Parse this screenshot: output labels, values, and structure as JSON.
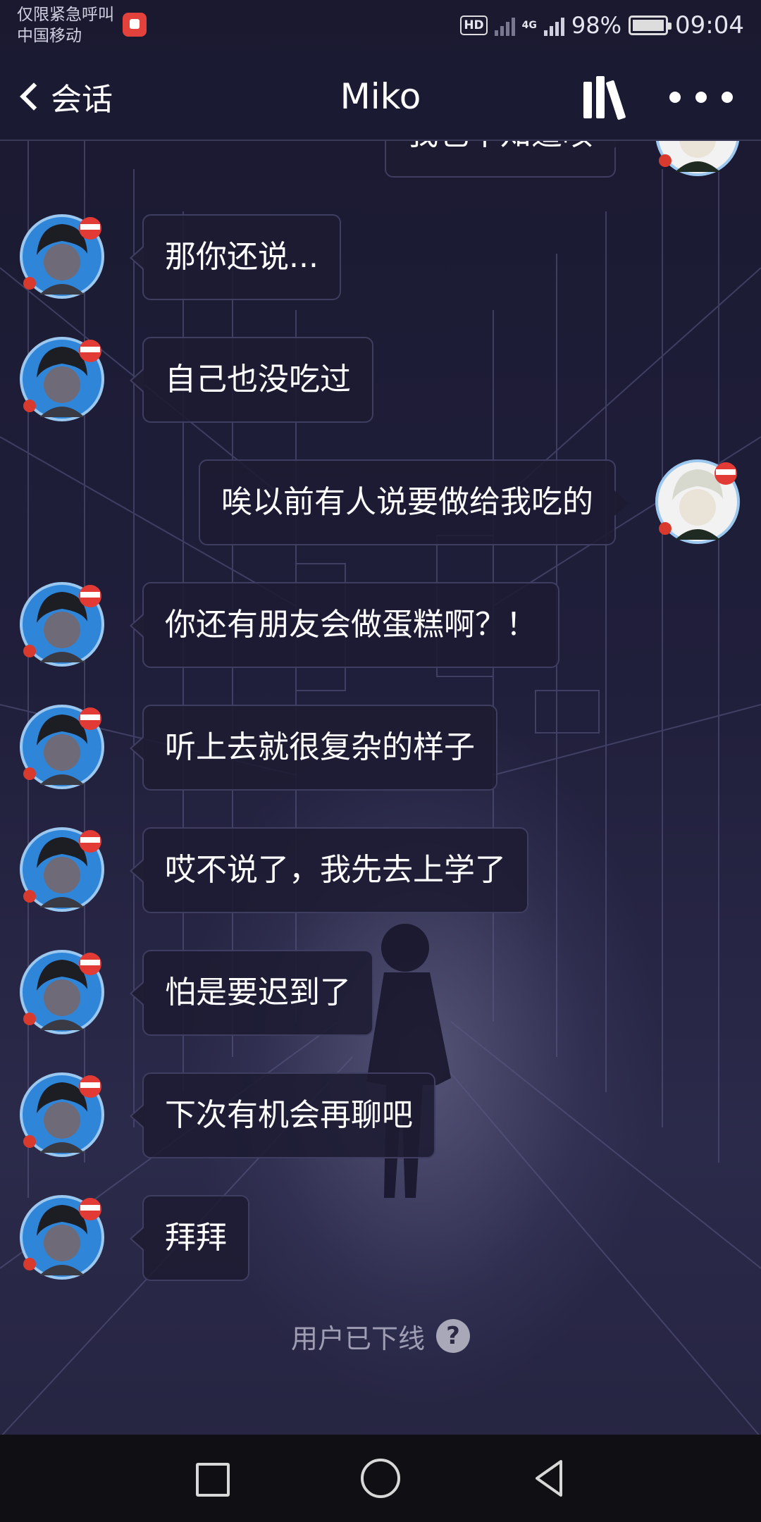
{
  "status_bar": {
    "carrier_line1": "仅限紧急呼叫",
    "carrier_line2": "中国移动",
    "hd": "HD",
    "network": "4G",
    "battery": "98%",
    "time": "09:04"
  },
  "header": {
    "back_label": "会话",
    "title": "Miko",
    "icons": [
      "back-chevron-icon",
      "bookshelf-icon",
      "more-dots-icon"
    ]
  },
  "messages": [
    {
      "side": "right",
      "text": "我也不知道咳"
    },
    {
      "side": "left",
      "text": "那你还说..."
    },
    {
      "side": "left",
      "text": "自己也没吃过"
    },
    {
      "side": "right",
      "text": "唉以前有人说要做给我吃的"
    },
    {
      "side": "left",
      "text": "你还有朋友会做蛋糕啊？！"
    },
    {
      "side": "left",
      "text": "听上去就很复杂的样子"
    },
    {
      "side": "left",
      "text": "哎不说了，我先去上学了"
    },
    {
      "side": "left",
      "text": "怕是要迟到了"
    },
    {
      "side": "left",
      "text": "下次有机会再聊吧"
    },
    {
      "side": "left",
      "text": "拜拜"
    }
  ],
  "offline_notice": "用户已下线",
  "help_symbol": "?",
  "nav": [
    "recent-apps-icon",
    "home-icon",
    "back-triangle-icon"
  ],
  "colors": {
    "background": "#1b1a33",
    "bubble": "#1c1b32",
    "bubble_border": "#3f3e60",
    "offline_text": "#9e9db4",
    "navbar": "#0f0f14"
  }
}
